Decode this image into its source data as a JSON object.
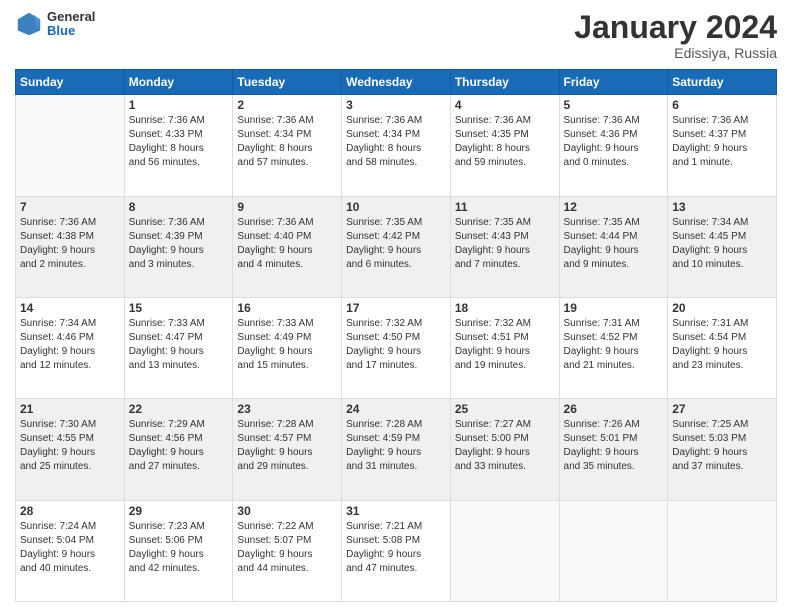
{
  "logo": {
    "general": "General",
    "blue": "Blue"
  },
  "header": {
    "title": "January 2024",
    "location": "Edissiya, Russia"
  },
  "weekdays": [
    "Sunday",
    "Monday",
    "Tuesday",
    "Wednesday",
    "Thursday",
    "Friday",
    "Saturday"
  ],
  "weeks": [
    [
      {
        "day": "",
        "info": ""
      },
      {
        "day": "1",
        "info": "Sunrise: 7:36 AM\nSunset: 4:33 PM\nDaylight: 8 hours\nand 56 minutes."
      },
      {
        "day": "2",
        "info": "Sunrise: 7:36 AM\nSunset: 4:34 PM\nDaylight: 8 hours\nand 57 minutes."
      },
      {
        "day": "3",
        "info": "Sunrise: 7:36 AM\nSunset: 4:34 PM\nDaylight: 8 hours\nand 58 minutes."
      },
      {
        "day": "4",
        "info": "Sunrise: 7:36 AM\nSunset: 4:35 PM\nDaylight: 8 hours\nand 59 minutes."
      },
      {
        "day": "5",
        "info": "Sunrise: 7:36 AM\nSunset: 4:36 PM\nDaylight: 9 hours\nand 0 minutes."
      },
      {
        "day": "6",
        "info": "Sunrise: 7:36 AM\nSunset: 4:37 PM\nDaylight: 9 hours\nand 1 minute."
      }
    ],
    [
      {
        "day": "7",
        "info": "Sunrise: 7:36 AM\nSunset: 4:38 PM\nDaylight: 9 hours\nand 2 minutes."
      },
      {
        "day": "8",
        "info": "Sunrise: 7:36 AM\nSunset: 4:39 PM\nDaylight: 9 hours\nand 3 minutes."
      },
      {
        "day": "9",
        "info": "Sunrise: 7:36 AM\nSunset: 4:40 PM\nDaylight: 9 hours\nand 4 minutes."
      },
      {
        "day": "10",
        "info": "Sunrise: 7:35 AM\nSunset: 4:42 PM\nDaylight: 9 hours\nand 6 minutes."
      },
      {
        "day": "11",
        "info": "Sunrise: 7:35 AM\nSunset: 4:43 PM\nDaylight: 9 hours\nand 7 minutes."
      },
      {
        "day": "12",
        "info": "Sunrise: 7:35 AM\nSunset: 4:44 PM\nDaylight: 9 hours\nand 9 minutes."
      },
      {
        "day": "13",
        "info": "Sunrise: 7:34 AM\nSunset: 4:45 PM\nDaylight: 9 hours\nand 10 minutes."
      }
    ],
    [
      {
        "day": "14",
        "info": "Sunrise: 7:34 AM\nSunset: 4:46 PM\nDaylight: 9 hours\nand 12 minutes."
      },
      {
        "day": "15",
        "info": "Sunrise: 7:33 AM\nSunset: 4:47 PM\nDaylight: 9 hours\nand 13 minutes."
      },
      {
        "day": "16",
        "info": "Sunrise: 7:33 AM\nSunset: 4:49 PM\nDaylight: 9 hours\nand 15 minutes."
      },
      {
        "day": "17",
        "info": "Sunrise: 7:32 AM\nSunset: 4:50 PM\nDaylight: 9 hours\nand 17 minutes."
      },
      {
        "day": "18",
        "info": "Sunrise: 7:32 AM\nSunset: 4:51 PM\nDaylight: 9 hours\nand 19 minutes."
      },
      {
        "day": "19",
        "info": "Sunrise: 7:31 AM\nSunset: 4:52 PM\nDaylight: 9 hours\nand 21 minutes."
      },
      {
        "day": "20",
        "info": "Sunrise: 7:31 AM\nSunset: 4:54 PM\nDaylight: 9 hours\nand 23 minutes."
      }
    ],
    [
      {
        "day": "21",
        "info": "Sunrise: 7:30 AM\nSunset: 4:55 PM\nDaylight: 9 hours\nand 25 minutes."
      },
      {
        "day": "22",
        "info": "Sunrise: 7:29 AM\nSunset: 4:56 PM\nDaylight: 9 hours\nand 27 minutes."
      },
      {
        "day": "23",
        "info": "Sunrise: 7:28 AM\nSunset: 4:57 PM\nDaylight: 9 hours\nand 29 minutes."
      },
      {
        "day": "24",
        "info": "Sunrise: 7:28 AM\nSunset: 4:59 PM\nDaylight: 9 hours\nand 31 minutes."
      },
      {
        "day": "25",
        "info": "Sunrise: 7:27 AM\nSunset: 5:00 PM\nDaylight: 9 hours\nand 33 minutes."
      },
      {
        "day": "26",
        "info": "Sunrise: 7:26 AM\nSunset: 5:01 PM\nDaylight: 9 hours\nand 35 minutes."
      },
      {
        "day": "27",
        "info": "Sunrise: 7:25 AM\nSunset: 5:03 PM\nDaylight: 9 hours\nand 37 minutes."
      }
    ],
    [
      {
        "day": "28",
        "info": "Sunrise: 7:24 AM\nSunset: 5:04 PM\nDaylight: 9 hours\nand 40 minutes."
      },
      {
        "day": "29",
        "info": "Sunrise: 7:23 AM\nSunset: 5:06 PM\nDaylight: 9 hours\nand 42 minutes."
      },
      {
        "day": "30",
        "info": "Sunrise: 7:22 AM\nSunset: 5:07 PM\nDaylight: 9 hours\nand 44 minutes."
      },
      {
        "day": "31",
        "info": "Sunrise: 7:21 AM\nSunset: 5:08 PM\nDaylight: 9 hours\nand 47 minutes."
      },
      {
        "day": "",
        "info": ""
      },
      {
        "day": "",
        "info": ""
      },
      {
        "day": "",
        "info": ""
      }
    ]
  ]
}
